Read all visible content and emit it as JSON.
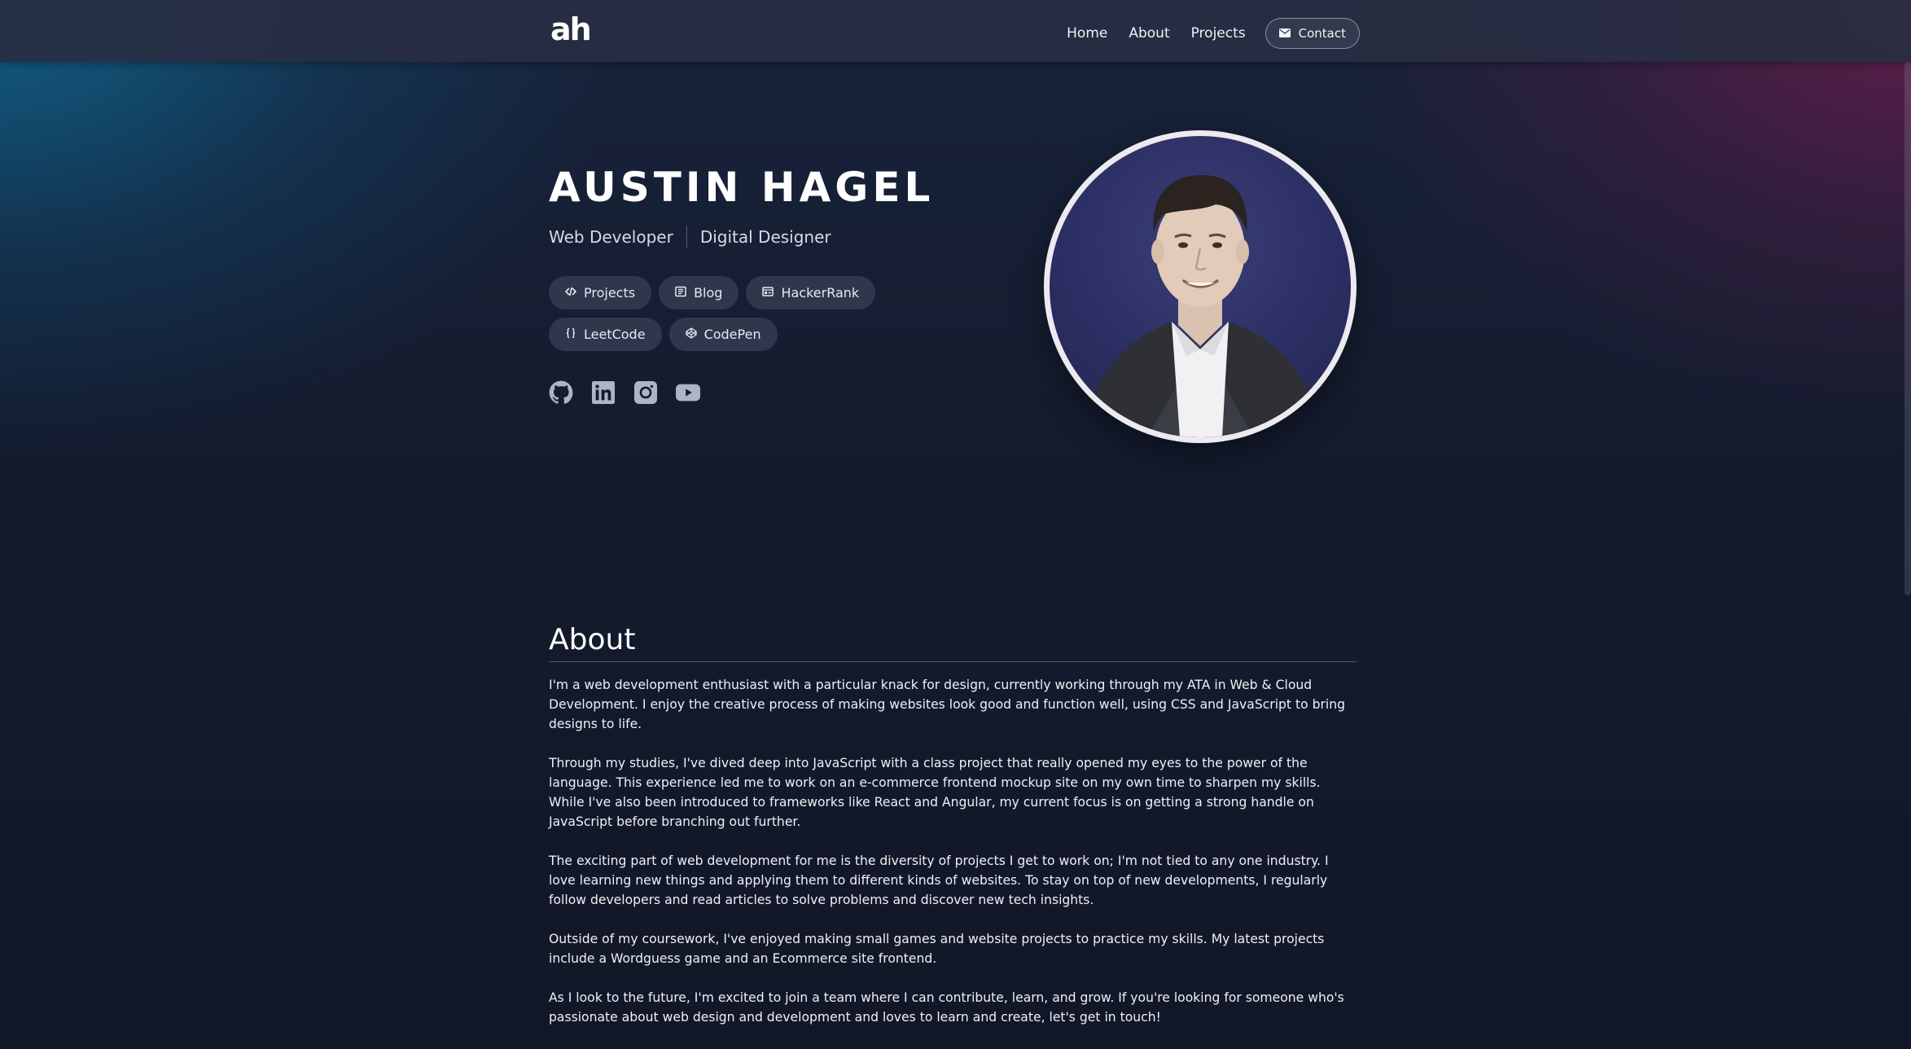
{
  "nav": {
    "logo": "ah",
    "links": [
      "Home",
      "About",
      "Projects"
    ],
    "contact_label": "Contact"
  },
  "hero": {
    "name": "AUSTIN HAGEL",
    "roles": [
      "Web Developer",
      "Digital Designer"
    ],
    "pills": [
      {
        "label": "Projects",
        "icon": "code-icon"
      },
      {
        "label": "Blog",
        "icon": "blog-icon"
      },
      {
        "label": "HackerRank",
        "icon": "hackerrank-icon"
      },
      {
        "label": "LeetCode",
        "icon": "braces-icon"
      },
      {
        "label": "CodePen",
        "icon": "codepen-icon"
      }
    ],
    "socials": [
      "github-icon",
      "linkedin-icon",
      "instagram-icon",
      "youtube-icon"
    ]
  },
  "about": {
    "title": "About",
    "paragraphs": [
      "I'm a web development enthusiast with a particular knack for design, currently working through my ATA in Web & Cloud Development. I enjoy the creative process of making websites look good and function well, using CSS and JavaScript to bring designs to life.",
      "Through my studies, I've dived deep into JavaScript with a class project that really opened my eyes to the power of the language. This experience led me to work on an e-commerce frontend mockup site on my own time to sharpen my skills. While I've also been introduced to frameworks like React and Angular, my current focus is on getting a strong handle on JavaScript before branching out further.",
      "The exciting part of web development for me is the diversity of projects I get to work on; I'm not tied to any one industry. I love learning new things and applying them to different kinds of websites. To stay on top of new developments, I regularly follow developers and read articles to solve problems and discover new tech insights.",
      "Outside of my coursework, I've enjoyed making small games and website projects to practice my skills. My latest projects include a Wordguess game and an Ecommerce site frontend.",
      "As I look to the future, I'm excited to join a team where I can contribute, learn, and grow. If you're looking for someone who's passionate about web design and development and loves to learn and create, let's get in touch!"
    ]
  },
  "colors": {
    "background": "#111827",
    "navbar": "#282e42",
    "pill": "#343c52",
    "accent_left": "#0e74a0",
    "accent_right": "#781c50"
  }
}
